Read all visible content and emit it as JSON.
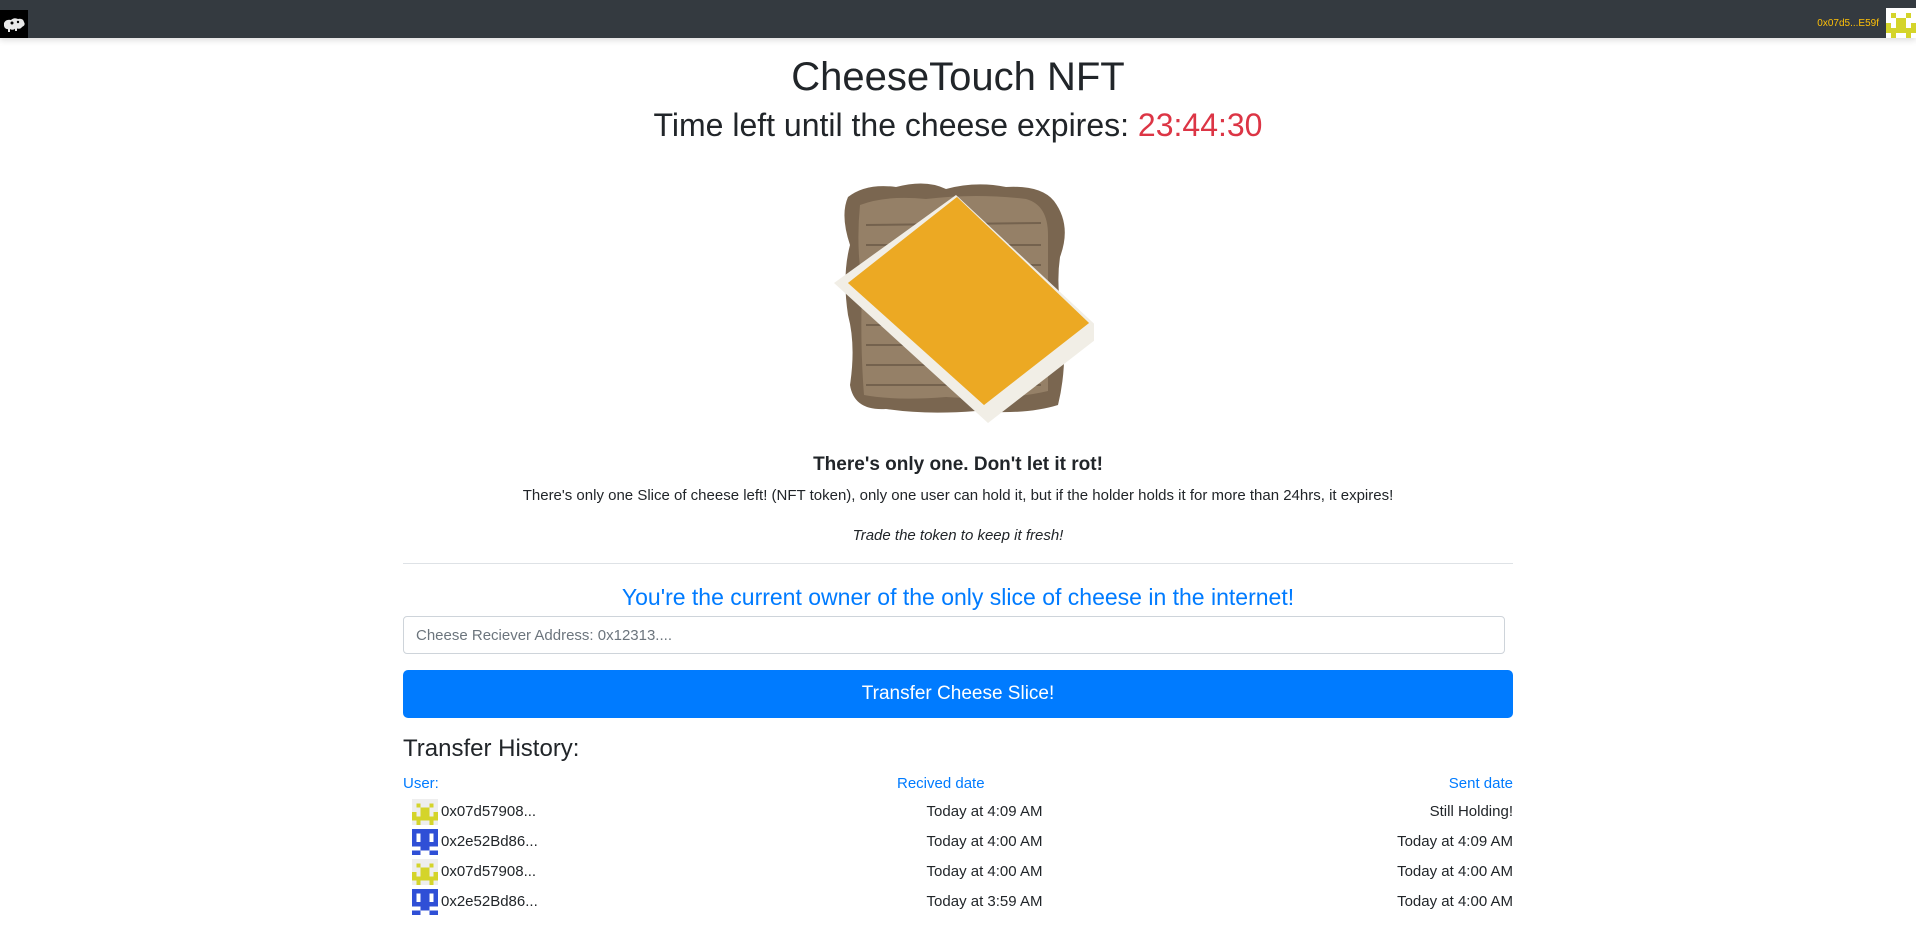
{
  "navbar": {
    "logo_icon": "cheese-logo-icon",
    "account_address": "0x07d5...E59f",
    "account_avatar_icon": "identicon-yellow-icon",
    "address_color": "#ffc107",
    "background": "#343a40"
  },
  "main": {
    "title": "CheeseTouch NFT",
    "timer_label": "Time left until the cheese expires: ",
    "timer_value": "23:44:30",
    "image_icon": "cheese-on-toast-image",
    "tagline": "There's only one. Don't let it rot!",
    "description": "There's only one Slice of cheese left! (NFT token), only one user can hold it, but if the holder holds it for more than 24hrs, it expires!",
    "call_to_action": "Trade the token to keep it fresh!",
    "owner_message": "You're the current owner of the only slice of cheese in the internet!"
  },
  "transfer": {
    "receiver_placeholder": "Cheese Reciever Address: 0x12313....",
    "receiver_value": "",
    "button_label": "Transfer Cheese Slice!",
    "button_color": "#007bff"
  },
  "history": {
    "title": "Transfer History:",
    "columns": {
      "user": "User:",
      "received": "Recived date",
      "sent": "Sent date"
    },
    "rows": [
      {
        "avatar_icon": "identicon-yellow-icon",
        "address": "0x07d57908...",
        "received": "Today at 4:09 AM",
        "sent": "Still Holding!"
      },
      {
        "avatar_icon": "identicon-blue-icon",
        "address": "0x2e52Bd86...",
        "received": "Today at 4:00 AM",
        "sent": "Today at 4:09 AM"
      },
      {
        "avatar_icon": "identicon-yellow-icon",
        "address": "0x07d57908...",
        "received": "Today at 4:00 AM",
        "sent": "Today at 4:00 AM"
      },
      {
        "avatar_icon": "identicon-blue-icon",
        "address": "0x2e52Bd86...",
        "received": "Today at 3:59 AM",
        "sent": "Today at 4:00 AM"
      }
    ]
  },
  "colors": {
    "countdown": "#dc3545",
    "accent_blue": "#007bff",
    "identicon_yellow": "#d4d42a",
    "identicon_blue": "#2f4fd6"
  }
}
